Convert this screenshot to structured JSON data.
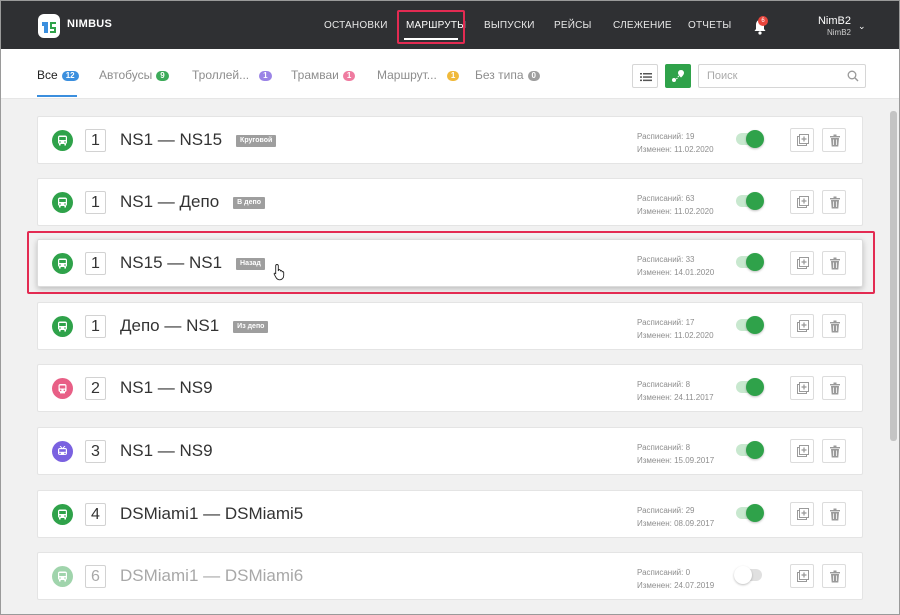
{
  "app": {
    "logo_text": "NIMBUS"
  },
  "nav": {
    "items": [
      {
        "label": "ОСТАНОВКИ"
      },
      {
        "label": "МАРШРУТЫ"
      },
      {
        "label": "ВЫПУСКИ"
      },
      {
        "label": "РЕЙСЫ"
      },
      {
        "label": "СЛЕЖЕНИЕ"
      },
      {
        "label": "ОТЧЕТЫ"
      }
    ],
    "active": "МАРШРУТЫ",
    "notifications": "6"
  },
  "user": {
    "name": "NimB2",
    "sub": "NimB2"
  },
  "tabs": [
    {
      "label": "Все",
      "count": "12",
      "color": "#3b8fde"
    },
    {
      "label": "Автобусы",
      "count": "9",
      "color": "#3dab5a"
    },
    {
      "label": "Троллей...",
      "count": "1",
      "color": "#9b84e6"
    },
    {
      "label": "Трамваи",
      "count": "1",
      "color": "#ef7ba0"
    },
    {
      "label": "Маршрут...",
      "count": "1",
      "color": "#f0b93a"
    },
    {
      "label": "Без типа",
      "count": "0",
      "color": "#9e9e9e"
    }
  ],
  "search": {
    "placeholder": "Поиск"
  },
  "colors": {
    "bus": "#2fa24a",
    "tram": "#e85f86",
    "trolley": "#7a61e0",
    "highlight": "#e32b52"
  },
  "routes": [
    {
      "num": "1",
      "name": "NS1 — NS15",
      "tag": "Круговой",
      "schedules": "Расписаний: 19",
      "changed": "Изменен: 11.02.2020",
      "type": "bus",
      "enabled": true
    },
    {
      "num": "1",
      "name": "NS1 — Депо",
      "tag": "В депо",
      "schedules": "Расписаний: 63",
      "changed": "Изменен: 11.02.2020",
      "type": "bus",
      "enabled": true
    },
    {
      "num": "1",
      "name": "NS15 — NS1",
      "tag": "Назад",
      "schedules": "Расписаний: 33",
      "changed": "Изменен: 14.01.2020",
      "type": "bus",
      "enabled": true
    },
    {
      "num": "1",
      "name": "Депо — NS1",
      "tag": "Из депо",
      "schedules": "Расписаний: 17",
      "changed": "Изменен: 11.02.2020",
      "type": "bus",
      "enabled": true
    },
    {
      "num": "2",
      "name": "NS1 — NS9",
      "tag": "",
      "schedules": "Расписаний: 8",
      "changed": "Изменен: 24.11.2017",
      "type": "tram",
      "enabled": true
    },
    {
      "num": "3",
      "name": "NS1 — NS9",
      "tag": "",
      "schedules": "Расписаний: 8",
      "changed": "Изменен: 15.09.2017",
      "type": "trolley",
      "enabled": true
    },
    {
      "num": "4",
      "name": "DSMiami1 — DSMiami5",
      "tag": "",
      "schedules": "Расписаний: 29",
      "changed": "Изменен: 08.09.2017",
      "type": "bus",
      "enabled": true
    },
    {
      "num": "6",
      "name": "DSMiami1 — DSMiami6",
      "tag": "",
      "schedules": "Расписаний: 0",
      "changed": "Изменен: 24.07.2019",
      "type": "bus",
      "enabled": false
    }
  ]
}
